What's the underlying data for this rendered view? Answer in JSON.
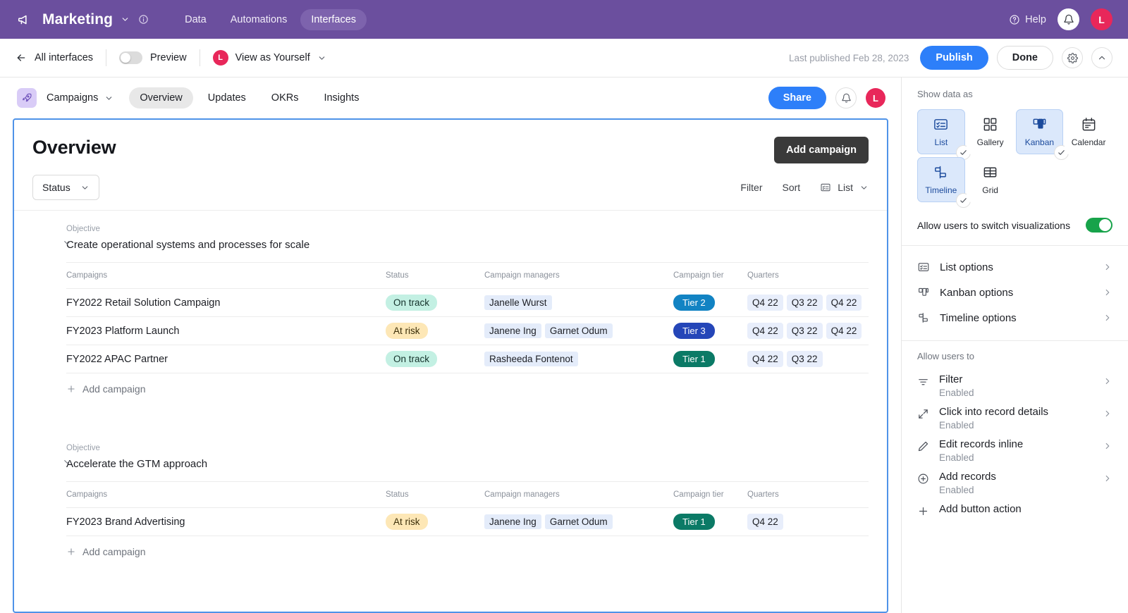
{
  "topbar": {
    "megaphone_icon": "megaphone-icon",
    "base_name": "Marketing",
    "caret_icon": "chevron-down-icon",
    "info_icon": "info-icon",
    "nav": [
      {
        "label": "Data",
        "active": false
      },
      {
        "label": "Automations",
        "active": false
      },
      {
        "label": "Interfaces",
        "active": true
      }
    ],
    "help_label": "Help",
    "help_icon": "question-circle-icon",
    "bell_icon": "bell-icon",
    "avatar_initial": "L",
    "bg_color": "#6b4f9e",
    "avatar_color": "#e8275a"
  },
  "subbar": {
    "back_icon": "arrow-left-icon",
    "back_label": "All interfaces",
    "preview_label": "Preview",
    "preview_on": false,
    "view_as_avatar": "L",
    "view_as_label": "View as Yourself",
    "view_as_caret": "chevron-down-icon",
    "last_published": "Last published Feb 28, 2023",
    "publish_label": "Publish",
    "done_label": "Done",
    "settings_icon": "gear-icon",
    "collapse_icon": "chevron-up-icon",
    "publish_color": "#2d7ff9"
  },
  "appbar": {
    "app_icon": "rocket-icon",
    "app_name": "Campaigns",
    "app_caret": "chevron-down-icon",
    "tabs": [
      {
        "label": "Overview",
        "active": true
      },
      {
        "label": "Updates",
        "active": false
      },
      {
        "label": "OKRs",
        "active": false
      },
      {
        "label": "Insights",
        "active": false
      }
    ],
    "share_label": "Share",
    "bell_icon": "bell-icon",
    "avatar_initial": "L"
  },
  "page": {
    "title": "Overview",
    "add_campaign_label": "Add campaign",
    "status_filter_label": "Status",
    "status_filter_caret": "chevron-down-icon",
    "filter_label": "Filter",
    "sort_label": "Sort",
    "view_icon": "list-view-icon",
    "view_label": "List",
    "view_caret": "chevron-down-icon",
    "selection_border_color": "#4f93e8"
  },
  "table": {
    "columns": [
      "Campaigns",
      "Status",
      "Campaign managers",
      "Campaign tier",
      "Quarters"
    ],
    "objective_label": "Objective",
    "add_campaign_label": "Add campaign",
    "collapse_icon": "chevron-down-icon",
    "plus_icon": "plus-icon"
  },
  "objectives": [
    {
      "label": "Objective",
      "title": "Create operational systems and processes for scale",
      "rows": [
        {
          "name": "FY2022 Retail Solution Campaign",
          "status": "On track",
          "status_kind": "ontrack",
          "managers": [
            "Janelle Wurst"
          ],
          "tier": "Tier 2",
          "tier_color": "#1283c3",
          "quarters": [
            "Q4 22",
            "Q3 22",
            "Q4 22"
          ]
        },
        {
          "name": "FY2023 Platform Launch",
          "status": "At risk",
          "status_kind": "atrisk",
          "managers": [
            "Janene Ing",
            "Garnet Odum"
          ],
          "tier": "Tier 3",
          "tier_color": "#2546b8",
          "quarters": [
            "Q4 22",
            "Q3 22",
            "Q4 22"
          ]
        },
        {
          "name": "FY2022 APAC Partner",
          "status": "On track",
          "status_kind": "ontrack",
          "managers": [
            "Rasheeda Fontenot"
          ],
          "tier": "Tier 1",
          "tier_color": "#0b7a66",
          "quarters": [
            "Q4 22",
            "Q3 22"
          ]
        }
      ]
    },
    {
      "label": "Objective",
      "title": "Accelerate the GTM approach",
      "rows": [
        {
          "name": "FY2023 Brand Advertising",
          "status": "At risk",
          "status_kind": "atrisk",
          "managers": [
            "Janene Ing",
            "Garnet Odum"
          ],
          "tier": "Tier 1",
          "tier_color": "#0b7a66",
          "quarters": [
            "Q4 22"
          ]
        }
      ]
    }
  ],
  "panel": {
    "show_data_as_label": "Show data as",
    "visualizations": [
      {
        "label": "List",
        "icon": "list-view-icon",
        "selected": true
      },
      {
        "label": "Gallery",
        "icon": "gallery-icon",
        "selected": false
      },
      {
        "label": "Kanban",
        "icon": "kanban-icon",
        "selected": true
      },
      {
        "label": "Calendar",
        "icon": "calendar-icon",
        "selected": false
      },
      {
        "label": "Timeline",
        "icon": "timeline-icon",
        "selected": true
      },
      {
        "label": "Grid",
        "icon": "grid-icon",
        "selected": false
      }
    ],
    "allow_switch_label": "Allow users to switch visualizations",
    "allow_switch_on": true,
    "allow_switch_color": "#17a34a",
    "options": [
      {
        "label": "List options",
        "icon": "list-view-icon",
        "chevron": "chevron-right-icon"
      },
      {
        "label": "Kanban options",
        "icon": "kanban-icon",
        "chevron": "chevron-right-icon"
      },
      {
        "label": "Timeline options",
        "icon": "timeline-icon",
        "chevron": "chevron-right-icon"
      }
    ],
    "allow_users_to_label": "Allow users to",
    "permissions": [
      {
        "label": "Filter",
        "state": "Enabled",
        "icon": "filter-icon"
      },
      {
        "label": "Click into record details",
        "state": "Enabled",
        "icon": "expand-icon"
      },
      {
        "label": "Edit records inline",
        "state": "Enabled",
        "icon": "pencil-icon"
      },
      {
        "label": "Add records",
        "state": "Enabled",
        "icon": "plus-circle-icon"
      }
    ],
    "add_button_action_label": "Add button action",
    "add_button_action_icon": "plus-icon"
  }
}
